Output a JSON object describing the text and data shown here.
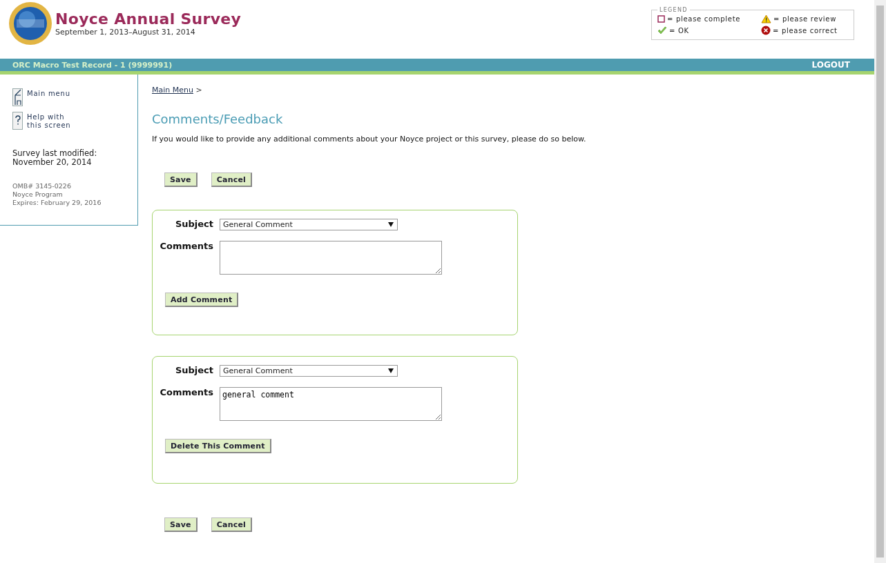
{
  "header": {
    "title": "Noyce Annual Survey",
    "subtitle": "September 1, 2013–August 31, 2014"
  },
  "legend": {
    "title": "LEGEND",
    "items": [
      {
        "kind": "complete",
        "label": "= please complete"
      },
      {
        "kind": "review",
        "label": "= please review"
      },
      {
        "kind": "ok",
        "label": "= OK"
      },
      {
        "kind": "correct",
        "label": "= please correct"
      }
    ]
  },
  "record_bar": {
    "record": "ORC Macro Test Record - 1 (9999991)",
    "logout": "LOGOUT"
  },
  "sidebar": {
    "links": [
      {
        "kind": "home",
        "label": "Main menu"
      },
      {
        "kind": "help",
        "label": "Help with this screen"
      }
    ],
    "modified_label": "Survey last modified:",
    "modified_date": "November 20, 2014",
    "omb": [
      "OMB# 3145-0226",
      "Noyce Program",
      "Expires: February 29, 2016"
    ]
  },
  "breadcrumb": {
    "link": "Main Menu",
    "separator": ">"
  },
  "heading": "Comments/Feedback",
  "intro": "If you would like to provide any additional comments about your Noyce project or this survey, please do so below.",
  "top_buttons": [
    "Save",
    "Cancel"
  ],
  "comments": [
    {
      "subject_label": "Subject",
      "subject": "General Comment",
      "comments_label": "Comments",
      "action": "Add Comment"
    },
    {
      "subject_label": "Subject",
      "subject": "General Comment",
      "comments_label": "Comments",
      "value": "general comment",
      "action": "Delete This Comment"
    }
  ],
  "bottom_buttons": [
    "Save",
    "Cancel"
  ]
}
